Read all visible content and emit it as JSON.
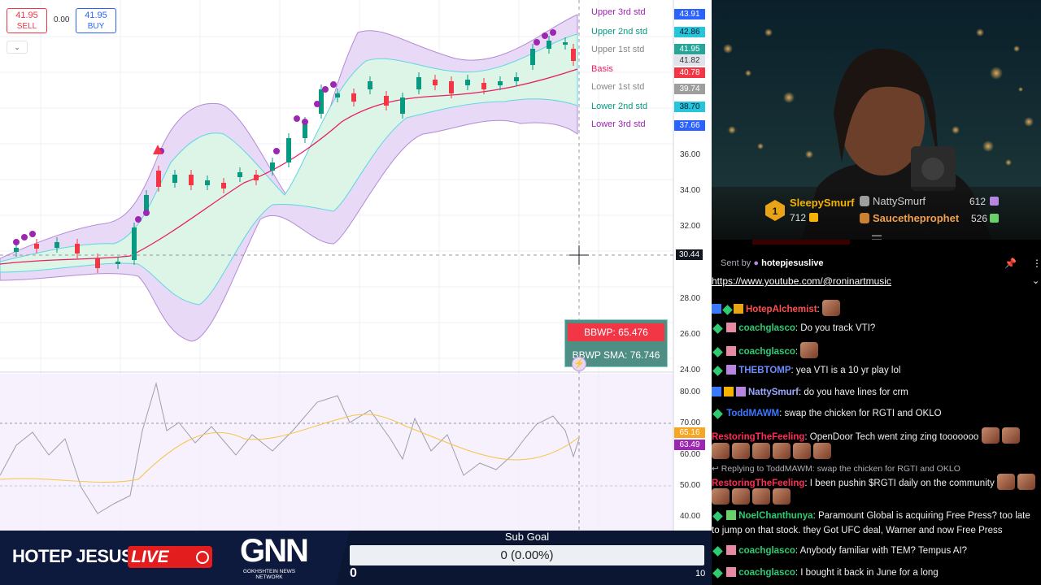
{
  "chart": {
    "sell_price": "41.95",
    "sell_label": "SELL",
    "spread": "0.00",
    "buy_price": "41.95",
    "buy_label": "BUY",
    "collapse_icon": "chevron-down-icon",
    "bands": [
      {
        "label": "Upper 3rd std",
        "value": "43.91",
        "color": "#9c27b0",
        "tag_bg": "#2962ff"
      },
      {
        "label": "Upper 2nd  std",
        "value": "42.86",
        "color": "#089981",
        "tag_bg": "#26c6da"
      },
      {
        "label": "Upper 1st std",
        "value": "41.95",
        "color": "#888888",
        "tag_bg": "#26a69a"
      },
      {
        "label": "Basis",
        "value": "40.78",
        "color": "#e91e63",
        "tag_bg": "#f23645"
      },
      {
        "label": "Lower 1st std",
        "value": "39.74",
        "color": "#888888",
        "tag_bg": "#9e9e9e"
      },
      {
        "label": "Lower 2nd std",
        "value": "38.70",
        "color": "#089981",
        "tag_bg": "#26c6da"
      },
      {
        "label": "Lower 3rd std",
        "value": "37.66",
        "color": "#9c27b0",
        "tag_bg": "#2962ff"
      }
    ],
    "extra_tags": [
      "41.82"
    ],
    "price_axis": [
      "36.00",
      "34.00",
      "32.00",
      "30.44",
      "28.00",
      "26.00",
      "24.00"
    ],
    "crosshair_price": "30.44",
    "bbwp_label": "BBWP: 65.476",
    "bbwp_sma_label": "BBWP SMA: 76.746",
    "osc_axis": [
      "80.00",
      "70.00",
      "60.00",
      "50.00",
      "40.00"
    ],
    "osc_tags": [
      {
        "value": "65.16",
        "bg": "#f5a623"
      },
      {
        "value": "63.49",
        "bg": "#9c27b0"
      }
    ],
    "colors": {
      "up": "#089981",
      "down": "#f23645",
      "signal": "#9c27b0",
      "outer_fill": "#e8d9f7",
      "inner_fill": "#dcf5e6"
    }
  },
  "stream": {
    "show_name": "HOTEP JESUS",
    "live_label": "LIVE",
    "network_logo": "GNN",
    "network_sub": "GOKHSHTEIN NEWS NETWORK",
    "sub_goal_title": "Sub Goal",
    "sub_goal_value": "0 (0.00%)",
    "sub_goal_min": "0",
    "sub_goal_max": "10"
  },
  "leaderboard": {
    "first": {
      "rank": "1",
      "name": "SleepySmurf",
      "count": "712"
    },
    "second": {
      "name": "NattySmurf",
      "count": "612"
    },
    "third": {
      "name": "Saucetheprophet",
      "count": "526"
    }
  },
  "chat": {
    "pinned_prefix": "Sent by",
    "pinned_user": "hotepjesuslive",
    "pinned_link": "https://www.youtube.com/@roninartmusic",
    "messages": [
      {
        "user": "HotepAlchemist",
        "color": "#ff4f4f",
        "text": ""
      },
      {
        "user": "coachglasco",
        "color": "#2ecc71",
        "text": "Do you track VTI?"
      },
      {
        "user": "coachglasco",
        "color": "#2ecc71",
        "text": ""
      },
      {
        "user": "THEBTOMP",
        "color": "#6a8cff",
        "text": "yea VTI is a 10 yr play lol"
      },
      {
        "user": "NattySmurf",
        "color": "#9aa8ff",
        "text": "do you have lines for crm"
      },
      {
        "user": "ToddMAWM",
        "color": "#3a78ff",
        "text": "swap the chicken for RGTI and OKLO"
      },
      {
        "user": "RestoringTheFeeling",
        "color": "#ff2d55",
        "text": "OpenDoor Tech went zing zing tooooooo"
      },
      {
        "user": "RestoringTheFeeling",
        "color": "#ff2d55",
        "text": "I been pushin $RGTI daily on the community",
        "reply": "Replying to ToddMAWM: swap the chicken for RGTI and OKLO"
      },
      {
        "user": "NoelChanthunya",
        "color": "#2ecc71",
        "text": "Paramount Global is acquiring Free Press? too late",
        "cont": "to jump on that stock. they Got UFC deal, Warner and now Free Press"
      },
      {
        "user": "coachglasco",
        "color": "#2ecc71",
        "text": "Anybody familiar with TEM? Tempus AI?"
      },
      {
        "user": "coachglasco",
        "color": "#2ecc71",
        "text": "I bought it back in June for a long"
      }
    ]
  }
}
